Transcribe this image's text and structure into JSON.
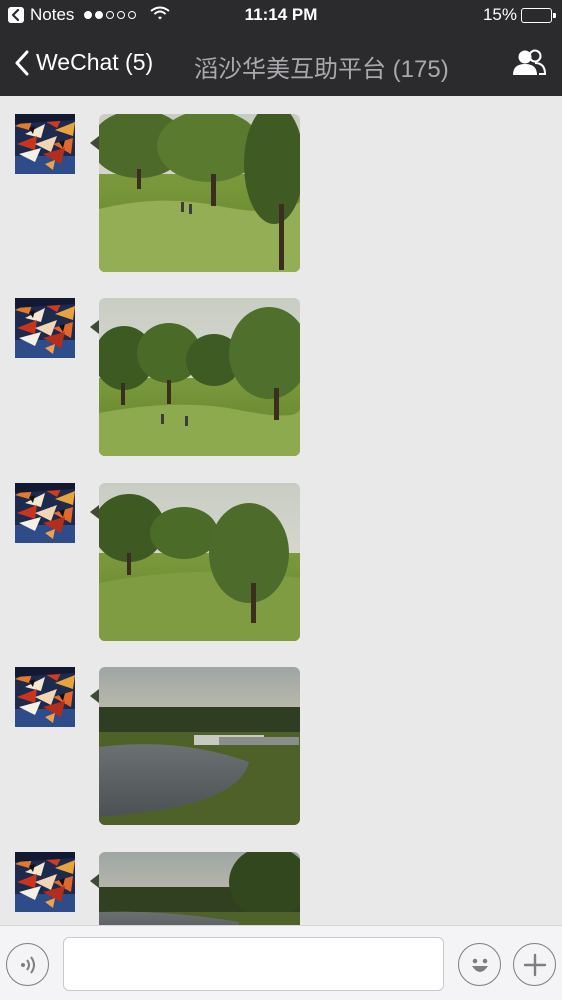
{
  "status_bar": {
    "back_app_label": "Notes",
    "time": "11:14 PM",
    "battery_text": "15%",
    "battery_level": 0.15,
    "signal_bars_filled": 2,
    "signal_bars_total": 5
  },
  "nav": {
    "back_label": "WeChat (5)",
    "title": "滔沙华美互助平台 (175)",
    "members_icon": "group-members-icon"
  },
  "messages": [
    {
      "sender": "avatar",
      "content_type": "photo",
      "photo_scene": "golf-course-trees-1"
    },
    {
      "sender": "avatar",
      "content_type": "photo",
      "photo_scene": "golf-course-trees-2"
    },
    {
      "sender": "avatar",
      "content_type": "photo",
      "photo_scene": "golf-course-trees-3"
    },
    {
      "sender": "avatar",
      "content_type": "photo",
      "photo_scene": "pond-dusk-1"
    },
    {
      "sender": "avatar",
      "content_type": "photo",
      "photo_scene": "pond-dusk-2"
    }
  ],
  "input_bar": {
    "voice_icon": "voice-input-icon",
    "text_value": "",
    "emoji_icon": "emoji-icon",
    "plus_icon": "plus-icon"
  },
  "colors": {
    "header_bg": "#2b2b2d",
    "title_color": "#a9a9ad",
    "chat_bg": "#e9e9e9",
    "battery_low": "#ff3b30"
  }
}
